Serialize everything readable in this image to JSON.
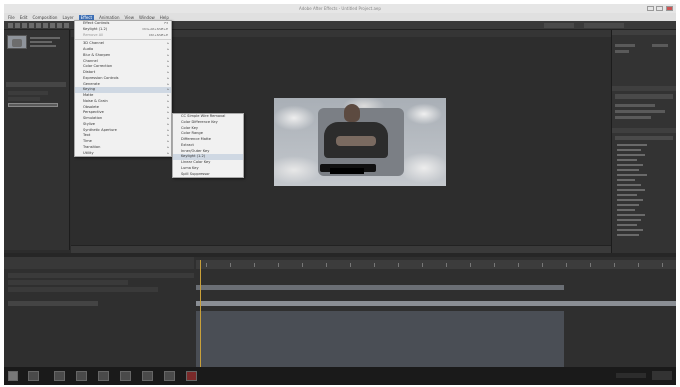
{
  "window": {
    "title": "Adobe After Effects - Untitled Project.aep"
  },
  "menubar": {
    "items": [
      "File",
      "Edit",
      "Composition",
      "Layer",
      "Effect",
      "Animation",
      "View",
      "Window",
      "Help"
    ],
    "open_index": 4
  },
  "effect_menu": {
    "items": [
      {
        "label": "Effect Controls",
        "shortcut": "F3"
      },
      {
        "label": "Keylight (1.2)",
        "shortcut": "Ctrl+Alt+Shift+E"
      },
      {
        "label": "Remove All",
        "shortcut": "Ctrl+Shift+E",
        "disabled": true
      },
      {
        "sep": true
      },
      {
        "label": "3D Channel",
        "arrow": true
      },
      {
        "label": "Audio",
        "arrow": true
      },
      {
        "label": "Blur & Sharpen",
        "arrow": true
      },
      {
        "label": "Channel",
        "arrow": true
      },
      {
        "label": "Color Correction",
        "arrow": true
      },
      {
        "label": "Distort",
        "arrow": true
      },
      {
        "label": "Expression Controls",
        "arrow": true
      },
      {
        "label": "Generate",
        "arrow": true
      },
      {
        "label": "Keying",
        "arrow": true,
        "highlight": true
      },
      {
        "label": "Matte",
        "arrow": true
      },
      {
        "label": "Noise & Grain",
        "arrow": true
      },
      {
        "label": "Obsolete",
        "arrow": true
      },
      {
        "label": "Perspective",
        "arrow": true
      },
      {
        "label": "Simulation",
        "arrow": true
      },
      {
        "label": "Stylize",
        "arrow": true
      },
      {
        "label": "Synthetic Aperture",
        "arrow": true
      },
      {
        "label": "Text",
        "arrow": true
      },
      {
        "label": "Time",
        "arrow": true
      },
      {
        "label": "Transition",
        "arrow": true
      },
      {
        "label": "Utility",
        "arrow": true
      }
    ]
  },
  "keying_menu": {
    "items": [
      {
        "label": "CC Simple Wire Removal"
      },
      {
        "label": "Color Difference Key"
      },
      {
        "label": "Color Key"
      },
      {
        "label": "Color Range"
      },
      {
        "label": "Difference Matte"
      },
      {
        "label": "Extract"
      },
      {
        "label": "Inner/Outer Key"
      },
      {
        "label": "Keylight (1.2)",
        "highlight": true
      },
      {
        "label": "Linear Color Key"
      },
      {
        "label": "Luma Key"
      },
      {
        "label": "Spill Suppressor"
      }
    ]
  }
}
